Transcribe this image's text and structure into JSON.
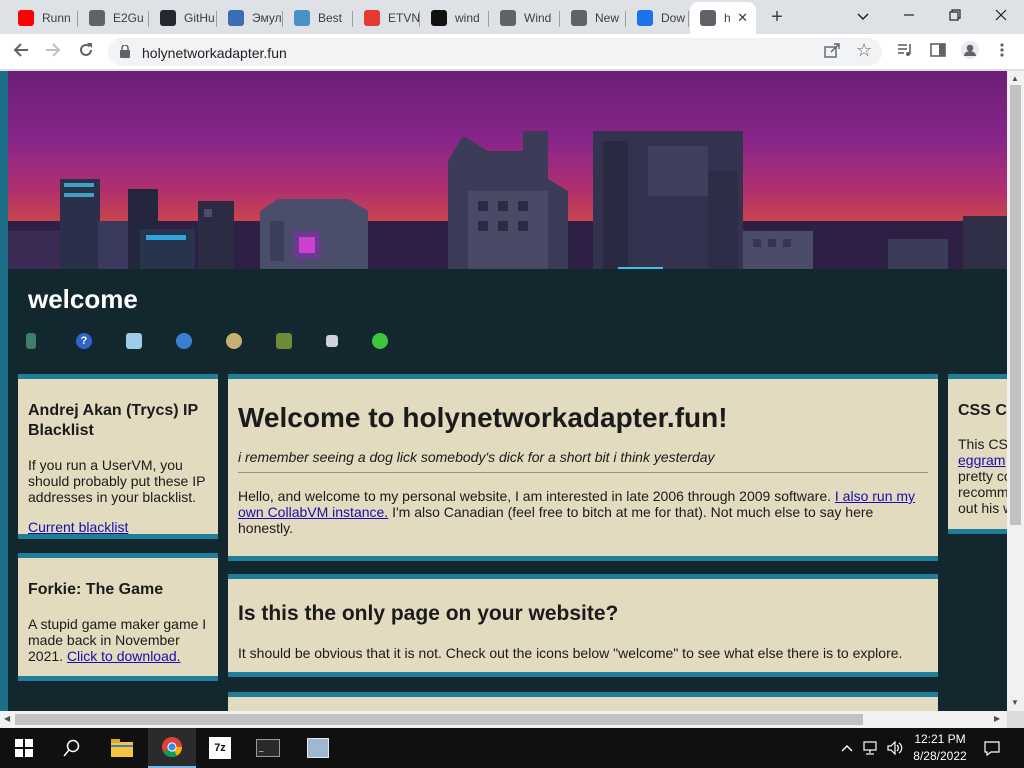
{
  "browser": {
    "tabs": [
      {
        "title": "Runn",
        "icon": "youtube-icon",
        "color": "#ff0000"
      },
      {
        "title": "E2Gu",
        "icon": "globe-icon",
        "color": "#5f6368"
      },
      {
        "title": "GitHu",
        "icon": "github-icon",
        "color": "#24292f"
      },
      {
        "title": "Эмул",
        "icon": "4pda-icon",
        "color": "#3b6db3"
      },
      {
        "title": "Best",
        "icon": "wolf-icon",
        "color": "#4a90c8"
      },
      {
        "title": "ETVN",
        "icon": "no-entry-icon",
        "color": "#e53935"
      },
      {
        "title": "wind",
        "icon": "question-icon",
        "color": "#111111"
      },
      {
        "title": "Wind",
        "icon": "globe-icon",
        "color": "#5f6368"
      },
      {
        "title": "New",
        "icon": "chrome-icon",
        "color": "#5f6368"
      },
      {
        "title": "Dow",
        "icon": "download-icon",
        "color": "#1a73e8"
      },
      {
        "title": "h",
        "icon": "globe-icon",
        "color": "#5f6368",
        "active": true
      }
    ],
    "url": "holynetworkadapter.fun"
  },
  "page": {
    "site_title": "welcome",
    "nav_icons": [
      "book-icon",
      "help-icon",
      "document-icon",
      "globe-network-icon",
      "users-icon",
      "cube-icon",
      "computer-icon",
      "green-orb-icon"
    ],
    "left_panels": [
      {
        "heading": "Andrej Akan (Trycs) IP Blacklist",
        "body": "If you run a UserVM, you should probably put these IP addresses in your blacklist.",
        "link": "Current blacklist"
      },
      {
        "heading": "Forkie: The Game",
        "body": "A stupid game maker game I made back in November 2021. ",
        "link": "Click to download."
      }
    ],
    "main": {
      "heading": "Welcome to holynetworkadapter.fun!",
      "tagline": "i remember seeing a dog lick somebody's dick for a short bit i think yesterday",
      "intro_before": "Hello, and welcome to my personal website, I am interested in late 2006 through 2009 software. ",
      "intro_link": "I also run my own CollabVM instance.",
      "intro_after": " I'm also Canadian (feel free to bitch at me for that). Not much else to say here honestly.",
      "q_heading": "Is this the only page on your website?",
      "q_body": "It should be obvious that it is not. Check out the icons below \"welcome\" to see what else there is to explore."
    },
    "right_panel": {
      "heading": "CSS C",
      "line1": "This CS",
      "link": "eggram",
      "line3": "pretty co",
      "line4": "recomm",
      "line5": "out his w"
    }
  },
  "taskbar": {
    "time": "12:21 PM",
    "date": "8/28/2022",
    "apps": [
      "file-explorer-icon",
      "chrome-icon",
      "7zip-icon",
      "terminal-icon",
      "control-panel-icon"
    ]
  },
  "colors": {
    "accent": "#1f7f9a",
    "panel": "#e2dbc0",
    "page_bg": "#13282e"
  }
}
